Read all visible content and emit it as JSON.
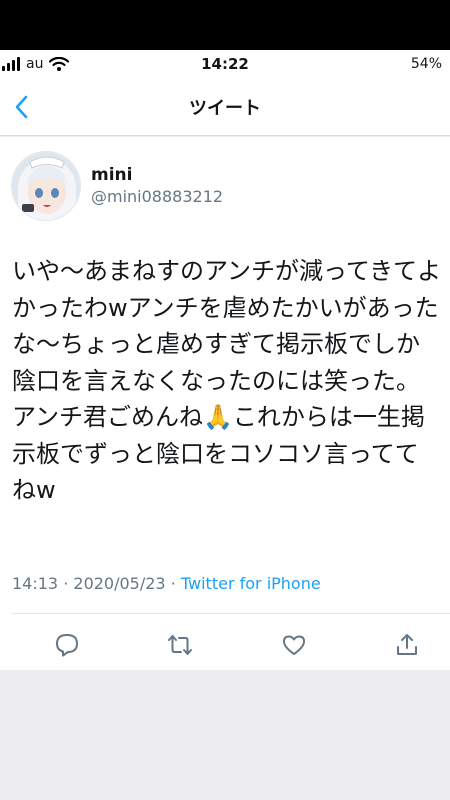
{
  "status_bar": {
    "carrier": "au",
    "time": "14:22",
    "battery": "54%"
  },
  "nav": {
    "title": "ツイート"
  },
  "tweet": {
    "display_name": "mini",
    "handle": "@mini08883212",
    "text": "いや〜あまねすのアンチが減ってきてよかったわwアンチを虐めたかいがあったな〜ちょっと虐めすぎて掲示板でしか陰口を言えなくなったのには笑った。アンチ君ごめんね🙏これからは一生掲示板でずっと陰口をコソコソ言っててねw",
    "time": "14:13",
    "date": "2020/05/23",
    "separator": "·",
    "source": "Twitter for iPhone"
  },
  "icons": {
    "back": "chevron-left-icon",
    "reply": "reply-icon",
    "retweet": "retweet-icon",
    "like": "heart-icon",
    "share": "share-icon"
  },
  "colors": {
    "accent": "#1da1f2",
    "secondary_text": "#657786",
    "primary_text": "#14171a",
    "background": "#ededf0"
  }
}
